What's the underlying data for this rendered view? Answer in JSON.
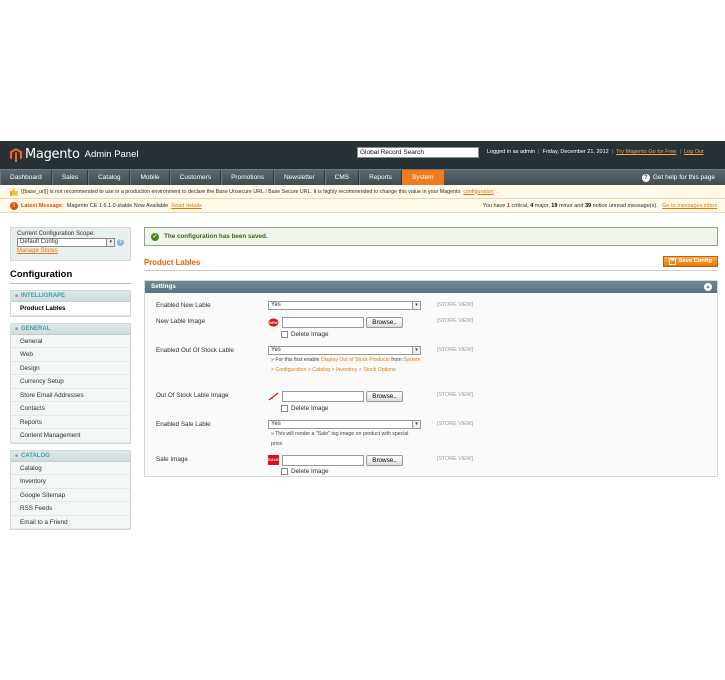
{
  "header": {
    "brand": "Magento",
    "panel": "Admin Panel",
    "search_value": "Global Record Search",
    "logged_in": "Logged in as admin",
    "date": "Friday, December 21, 2012",
    "try_link": "Try Magento Go for Free",
    "logout": "Log Out"
  },
  "nav": {
    "items": [
      "Dashboard",
      "Sales",
      "Catalog",
      "Mobile",
      "Customers",
      "Promotions",
      "Newsletter",
      "CMS",
      "Reports",
      "System"
    ],
    "active": "System",
    "help": "Get help for this page"
  },
  "notice": {
    "text": "{{base_url}} is not recommended to use in a production environment to declare the Base Unsecure URL / Base Secure URL. It is highly recommended to change this value in your Magento",
    "link": "configuration",
    "period": "."
  },
  "latest": {
    "label": "Latest Message:",
    "text": "Magento CE 1.6.1.0-stable Now Available",
    "link": "Read details",
    "you_have": "You have",
    "critical_count": "1",
    "critical": "critical,",
    "major_count": "4",
    "major": "major,",
    "minor_count": "19",
    "minor": "minor and",
    "notice_count": "39",
    "notice": "notice unread message(s).",
    "inbox_link": "Go to messages inbox"
  },
  "sidebar": {
    "scope_label": "Current Configuration Scope:",
    "scope_value": "Default Config",
    "manage_stores": "Manage Stores",
    "title": "Configuration",
    "groups": [
      {
        "title": "INTELLIGRAPE",
        "items": [
          "Product Lables"
        ]
      },
      {
        "title": "GENERAL",
        "items": [
          "General",
          "Web",
          "Design",
          "Currency Setup",
          "Store Email Addresses",
          "Contacts",
          "Reports",
          "Content Management"
        ]
      },
      {
        "title": "CATALOG",
        "items": [
          "Catalog",
          "Inventory",
          "Google Sitemap",
          "RSS Feeds",
          "Email to a Friend"
        ]
      }
    ],
    "active_item": "Product Lables"
  },
  "main": {
    "success": "The configuration has been saved.",
    "page_title": "Product Lables",
    "save_button": "Save Config",
    "section_title": "Settings",
    "store_view": "[STORE VIEW]",
    "fields": {
      "enabled_new_label": "Enabled New Lable",
      "enabled_new_value": "Yes",
      "new_image_label": "New Lable Image",
      "browse": "Browse..",
      "delete_image": "Delete Image",
      "enabled_oos_label": "Enabled Out Of Stock Lable",
      "enabled_oos_value": "Yes",
      "oos_note_prefix": "For this first enable",
      "oos_note_link": "Display Out of Stock Products",
      "oos_note_from": "from",
      "oos_note_path": "System > Configuration > Catalog > Inventory > Stock Options",
      "oos_image_label": "Out Of Stock Lable Image",
      "enabled_sale_label": "Enabled Sale Lable",
      "enabled_sale_value": "Yes",
      "sale_note": "This will render a \"Sale\" tag image on product with special price.",
      "sale_image_label": "Sale Image",
      "sale_icon_text": "SALE"
    }
  },
  "colors": {
    "header_bg": "#283236",
    "accent": "#ea7601",
    "active_tab": "#f07a1e",
    "section_header": "#577480"
  }
}
